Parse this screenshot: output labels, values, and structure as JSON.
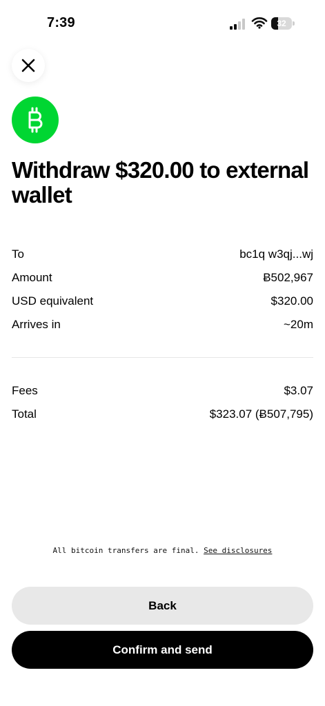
{
  "status_bar": {
    "time": "7:39",
    "battery": "32"
  },
  "header": {
    "title": "Withdraw $320.00 to external wallet"
  },
  "details": {
    "to_label": "To",
    "to_value": "bc1q w3qj...wj",
    "amount_label": "Amount",
    "amount_value": "Ƀ502,967",
    "usd_label": "USD equivalent",
    "usd_value": "$320.00",
    "arrives_label": "Arrives in",
    "arrives_value": "~20m"
  },
  "fees": {
    "fees_label": "Fees",
    "fees_value": "$3.07",
    "total_label": "Total",
    "total_value": "$323.07 (Ƀ507,795)"
  },
  "disclosure": {
    "text": "All bitcoin transfers are final.",
    "link": "See disclosures"
  },
  "actions": {
    "back_label": "Back",
    "confirm_label": "Confirm and send"
  },
  "icons": {
    "close": "close-icon",
    "bitcoin": "bitcoin-icon",
    "signal": "signal-icon",
    "wifi": "wifi-icon",
    "battery": "battery-icon"
  },
  "colors": {
    "bitcoin_green": "#00d632",
    "primary_button": "#000000",
    "secondary_button": "#e8e8e8"
  }
}
